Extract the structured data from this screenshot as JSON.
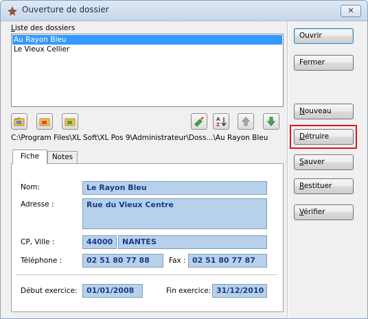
{
  "window": {
    "title": "Ouverture de dossier",
    "close_symbol": "✕",
    "title_icon": "app-logo-icon"
  },
  "folder_list": {
    "label": "Liste des dossiers",
    "items": [
      {
        "name": "Au Rayon Bleu",
        "selected": true
      },
      {
        "name": "Le Vieux Cellier",
        "selected": false
      }
    ]
  },
  "toolbar": {
    "icons": [
      "folder-open-icon",
      "folder-close-icon",
      "folder-new-icon",
      "brush-icon",
      "sort-az-icon",
      "arrow-up-icon",
      "arrow-down-icon"
    ]
  },
  "path": "C:\\Program Files\\XL Soft\\XL Pos 9\\Administrateur\\Doss...\\Au Rayon Bleu",
  "tabs": [
    {
      "label": "Fiche",
      "active": true
    },
    {
      "label": "Notes",
      "active": false
    }
  ],
  "form": {
    "nom_label": "Nom:",
    "nom_value": "Le Rayon Bleu",
    "adresse_label": "Adresse :",
    "adresse_value": "Rue du Vieux Centre",
    "cp_ville_label": "CP, Ville :",
    "cp_value": "44000",
    "ville_value": "NANTES",
    "telephone_label": "Téléphone :",
    "telephone_value": "02 51 80 77 88",
    "fax_label": "Fax :",
    "fax_value": "02 51 80 77 87",
    "debut_label": "Début exercice:",
    "debut_value": "01/01/2008",
    "fin_label": "Fin exercice:",
    "fin_value": "31/12/2010"
  },
  "side_buttons": {
    "ouvrir": "Ouvrir",
    "fermer": "Fermer",
    "nouveau": "Nouveau",
    "detruire": "Détruire",
    "sauver": "Sauver",
    "restituer": "Restituer",
    "verifier": "Vérifier"
  },
  "colors": {
    "selection": "#3399ff",
    "field_bg": "#b8d1eb",
    "field_text": "#1a3a8a",
    "highlight": "#e1141b"
  }
}
